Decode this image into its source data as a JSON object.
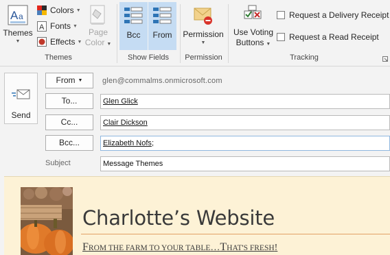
{
  "ribbon": {
    "themes": {
      "themes_label": "Themes",
      "colors_label": "Colors",
      "fonts_label": "Fonts",
      "effects_label": "Effects",
      "page_color_line1": "Page",
      "page_color_line2": "Color",
      "group_label": "Themes"
    },
    "show_fields": {
      "bcc_label": "Bcc",
      "from_label": "From",
      "group_label": "Show Fields"
    },
    "permission": {
      "permission_label": "Permission",
      "group_label": "Permission"
    },
    "tracking": {
      "voting_line1": "Use Voting",
      "voting_line2": "Buttons",
      "delivery_receipt": "Request a Delivery Receipt",
      "read_receipt": "Request a Read Receipt",
      "group_label": "Tracking"
    }
  },
  "header": {
    "send_label": "Send",
    "from_button": "From",
    "from_address": "glen@commalms.onmicrosoft.com",
    "to_button": "To...",
    "to_value": "Glen Glick",
    "cc_button": "Cc...",
    "cc_value": "Clair Dickson",
    "bcc_button": "Bcc...",
    "bcc_value": "Elizabeth Nofs",
    "bcc_trailing": ";",
    "subject_label": "Subject",
    "subject_value": "Message Themes"
  },
  "body": {
    "site_title": "Charlotte’s Website",
    "tagline_f": "F",
    "tagline_rom_the_farm": "ROM THE FARM TO YOUR TABLE",
    "tagline_dots": "…",
    "tagline_t": "T",
    "tagline_hats_fresh": "HAT'S FRESH",
    "tagline_bang": "!"
  },
  "colors": {
    "accent_selected": "#c5dcf3",
    "body_background": "#fdf2d6",
    "title_rule": "#e2a064"
  }
}
